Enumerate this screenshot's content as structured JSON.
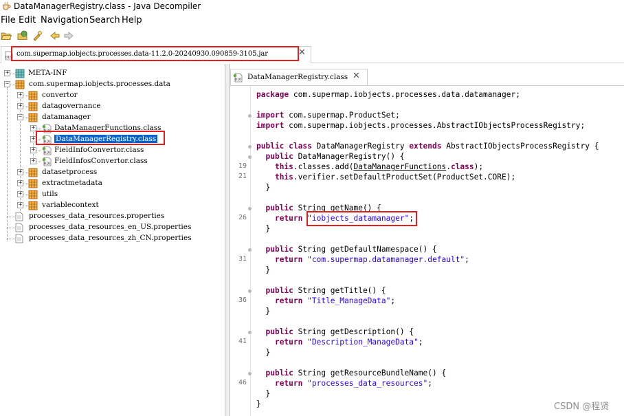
{
  "window": {
    "title": "DataManagerRegistry.class - Java Decompiler"
  },
  "menu": [
    "File",
    "Edit",
    "Navigation",
    "Search",
    "Help"
  ],
  "toolbar": [
    "open-file-icon",
    "open-type-icon",
    "search-icon",
    "back-icon",
    "forward-icon"
  ],
  "jar_tab": {
    "label": "com.supermap.iobjects.processes.data-11.2.0-20240930.090859-3105.jar",
    "close": "✕"
  },
  "tree": [
    {
      "label": "META-INF",
      "icon": "package-icon",
      "expander": "+"
    },
    {
      "label": "com.supermap.iobjects.processes.data",
      "icon": "package-icon",
      "expander": "−"
    },
    {
      "label": "convertor",
      "icon": "package-icon",
      "expander": "+"
    },
    {
      "label": "datagovernance",
      "icon": "package-icon",
      "expander": "+"
    },
    {
      "label": "datamanager",
      "icon": "package-icon",
      "expander": "−"
    },
    {
      "label": "DataManagerFunctions.class",
      "icon": "class-file-icon",
      "expander": "+"
    },
    {
      "label": "DataManagerRegistry.class",
      "icon": "class-file-icon",
      "expander": "+",
      "selected": true
    },
    {
      "label": "FieldInfoConvertor.class",
      "icon": "class-file-icon",
      "expander": "+"
    },
    {
      "label": "FieldInfosConvertor.class",
      "icon": "class-file-icon",
      "expander": "+"
    },
    {
      "label": "datasetprocess",
      "icon": "package-icon",
      "expander": "+"
    },
    {
      "label": "extractmetadata",
      "icon": "package-icon",
      "expander": "+"
    },
    {
      "label": "utils",
      "icon": "package-icon",
      "expander": "+"
    },
    {
      "label": "variablecontext",
      "icon": "package-icon",
      "expander": "+"
    },
    {
      "label": "processes_data_resources.properties",
      "icon": "file-icon"
    },
    {
      "label": "processes_data_resources_en_US.properties",
      "icon": "file-icon"
    },
    {
      "label": "processes_data_resources_zh_CN.properties",
      "icon": "file-icon"
    }
  ],
  "code_tab": {
    "label": "DataManagerRegistry.class",
    "close": "✕"
  },
  "code": [
    {
      "ln": "",
      "text": "package com.supermap.iobjects.processes.data.datamanager;"
    },
    {
      "ln": "",
      "text": ""
    },
    {
      "ln": "",
      "text": "import com.supermap.ProductSet;"
    },
    {
      "ln": "",
      "text": "import com.supermap.iobjects.processes.AbstractIObjectsProcessRegistry;"
    },
    {
      "ln": "",
      "text": ""
    },
    {
      "ln": "",
      "text": "public class DataManagerRegistry extends AbstractIObjectsProcessRegistry {"
    },
    {
      "ln": "",
      "text": "  public DataManagerRegistry() {"
    },
    {
      "ln": "19",
      "text": "    this.classes.add(DataManagerFunctions.class);"
    },
    {
      "ln": "21",
      "text": "    this.verifier.setDefaultProductSet(ProductSet.CORE);"
    },
    {
      "ln": "",
      "text": "  }"
    },
    {
      "ln": "",
      "text": ""
    },
    {
      "ln": "",
      "text": "  public String getName() {"
    },
    {
      "ln": "26",
      "text": "    return \"iobjects_datamanager\";"
    },
    {
      "ln": "",
      "text": "  }"
    },
    {
      "ln": "",
      "text": ""
    },
    {
      "ln": "",
      "text": "  public String getDefaultNamespace() {"
    },
    {
      "ln": "31",
      "text": "    return \"com.supermap.datamanager.default\";"
    },
    {
      "ln": "",
      "text": "  }"
    },
    {
      "ln": "",
      "text": ""
    },
    {
      "ln": "",
      "text": "  public String getTitle() {"
    },
    {
      "ln": "36",
      "text": "    return \"Title_ManageData\";"
    },
    {
      "ln": "",
      "text": "  }"
    },
    {
      "ln": "",
      "text": ""
    },
    {
      "ln": "",
      "text": "  public String getDescription() {"
    },
    {
      "ln": "41",
      "text": "    return \"Description_ManageData\";"
    },
    {
      "ln": "",
      "text": "  }"
    },
    {
      "ln": "",
      "text": ""
    },
    {
      "ln": "",
      "text": "  public String getResourceBundleName() {"
    },
    {
      "ln": "46",
      "text": "    return \"processes_data_resources\";"
    },
    {
      "ln": "",
      "text": "  }"
    },
    {
      "ln": "",
      "text": "}"
    }
  ],
  "watermark": "CSDN @程贤",
  "colors": {
    "keyword": "#7f0055",
    "string": "#2a00ff",
    "selection": "#0a64c8",
    "highlight_box": "#e02020"
  }
}
